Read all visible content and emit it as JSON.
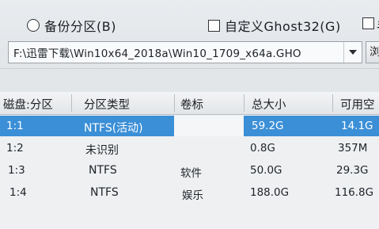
{
  "options": {
    "backup_partition_label": "备份分区(B)",
    "custom_ghost_label": "自定义Ghost32(G)",
    "third_option_label": "手"
  },
  "image_path": {
    "value": "F:\\迅雷下载\\Win10x64_2018a\\Win10_1709_x64a.GHO",
    "browse_label": "浏"
  },
  "table": {
    "headers": [
      "磁盘:分区",
      "分区类型",
      "卷标",
      "总大小",
      "可用空"
    ],
    "rows": [
      {
        "disk": "1:1",
        "type": "NTFS(活动)",
        "label": "",
        "total": "59.2G",
        "free": "14.1G",
        "selected": true
      },
      {
        "disk": "1:2",
        "type": "未识别",
        "label": "",
        "total": "0.8G",
        "free": "357M",
        "selected": false
      },
      {
        "disk": "1:3",
        "type": "NTFS",
        "label": "软件",
        "total": "50.0G",
        "free": "29.3G",
        "selected": false
      },
      {
        "disk": "1:4",
        "type": "NTFS",
        "label": "娱乐",
        "total": "188.0G",
        "free": "116.8G",
        "selected": false
      }
    ]
  },
  "colors": {
    "selection": "#3b8fd6"
  }
}
